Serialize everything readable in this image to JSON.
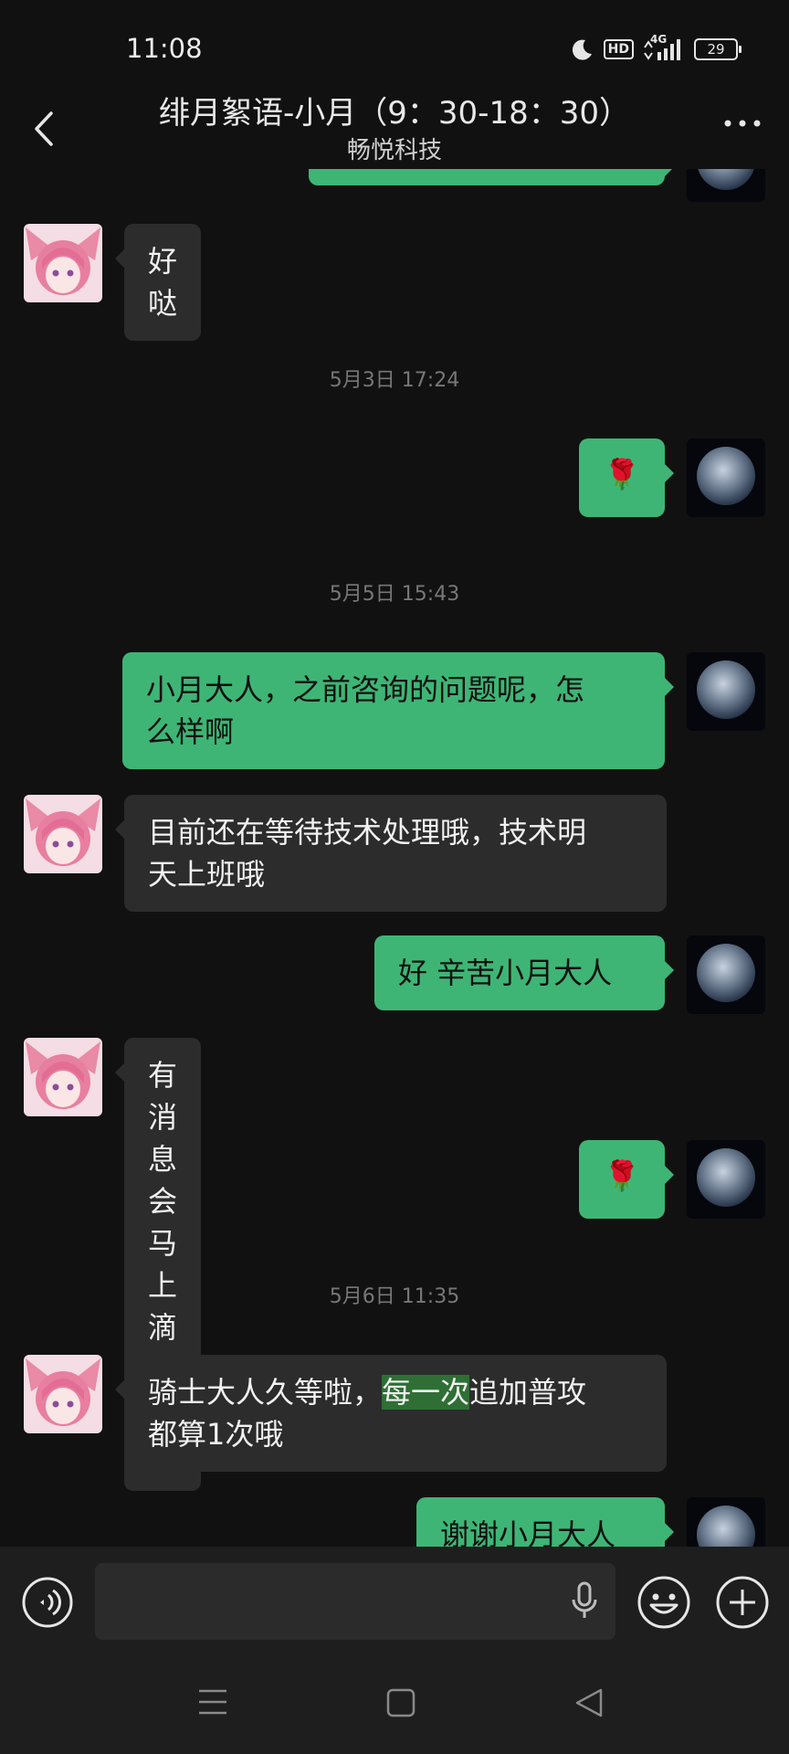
{
  "status_bar": {
    "time": "11:08",
    "hd_label": "HD",
    "network_label": "4G",
    "battery_level": "29"
  },
  "header": {
    "title": "绯月絮语-小月（9：30-18：30）",
    "subtitle": "畅悦科技"
  },
  "messages": [
    {
      "type": "text",
      "sender": "agent",
      "text": "好哒"
    },
    {
      "type": "timestamp",
      "text": "5月3日 17:24"
    },
    {
      "type": "emoji",
      "sender": "user",
      "emoji": "🌹"
    },
    {
      "type": "timestamp",
      "text": "5月5日 15:43"
    },
    {
      "type": "text",
      "sender": "user",
      "lines": [
        "小月大人，之前咨询的问题呢，怎",
        "么样啊"
      ]
    },
    {
      "type": "text",
      "sender": "agent",
      "lines": [
        "目前还在等待技术处理哦，技术明",
        "天上班哦"
      ]
    },
    {
      "type": "text",
      "sender": "user",
      "text": "好 辛苦小月大人"
    },
    {
      "type": "text",
      "sender": "agent",
      "text": "有消息会马上滴滴您哒"
    },
    {
      "type": "emoji",
      "sender": "user",
      "emoji": "🌹"
    },
    {
      "type": "timestamp",
      "text": "5月6日 11:35"
    },
    {
      "type": "text",
      "sender": "agent",
      "line1_before": "骑士大人久等啦，",
      "line1_highlight": "每一次",
      "line1_after": "追加普攻",
      "line2": "都算1次哦"
    },
    {
      "type": "text",
      "sender": "user",
      "text": "谢谢小月大人"
    }
  ],
  "colors": {
    "background": "#111111",
    "bubble_in": "#2c2c2c",
    "bubble_out": "#3eb575",
    "highlight": "#2f6f35"
  },
  "icons": {
    "back": "chevron-left-icon",
    "more": "more-dots-icon",
    "voice": "voice-icon",
    "mic": "microphone-icon",
    "emoji": "smile-icon",
    "plus": "plus-icon",
    "nav_menu": "menu-icon",
    "nav_home": "home-square-icon",
    "nav_back": "triangle-back-icon"
  }
}
